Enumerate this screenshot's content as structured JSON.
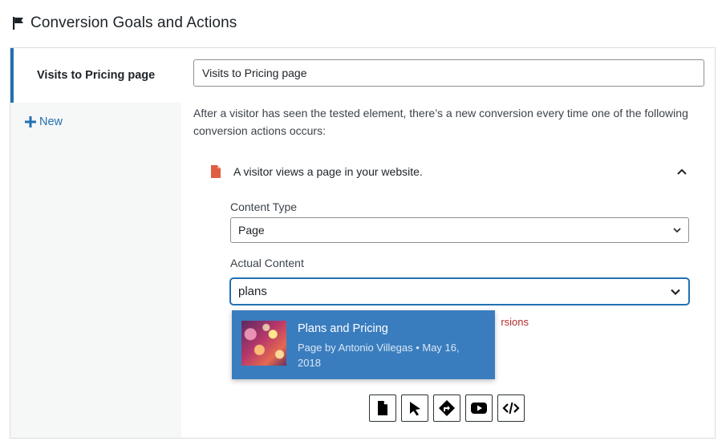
{
  "header": {
    "title": "Conversion Goals and Actions"
  },
  "sidebar": {
    "goals": [
      {
        "label": "Visits to Pricing page"
      }
    ],
    "new_label": "New"
  },
  "goal": {
    "name_value": "Visits to Pricing page",
    "description": "After a visitor has seen the tested element, there’s a new conversion every time one of the following conversion actions occurs:"
  },
  "action": {
    "label": "A visitor views a page in your website.",
    "content_type_label": "Content Type",
    "content_type_value": "Page",
    "actual_content_label": "Actual Content",
    "search_value": "plans",
    "error_partial": "rsions",
    "suggestion": {
      "title": "Plans and Pricing",
      "meta": "Page by Antonio Villegas • May 16, 2018"
    }
  },
  "action_types": [
    {
      "icon": "page-icon"
    },
    {
      "icon": "cursor-click-icon"
    },
    {
      "icon": "route-sign-icon"
    },
    {
      "icon": "youtube-icon"
    },
    {
      "icon": "code-icon"
    }
  ],
  "colors": {
    "accent": "#2271b1",
    "selection": "#3a7dbf",
    "error": "#b32d2e",
    "page_icon": "#e05d44"
  }
}
